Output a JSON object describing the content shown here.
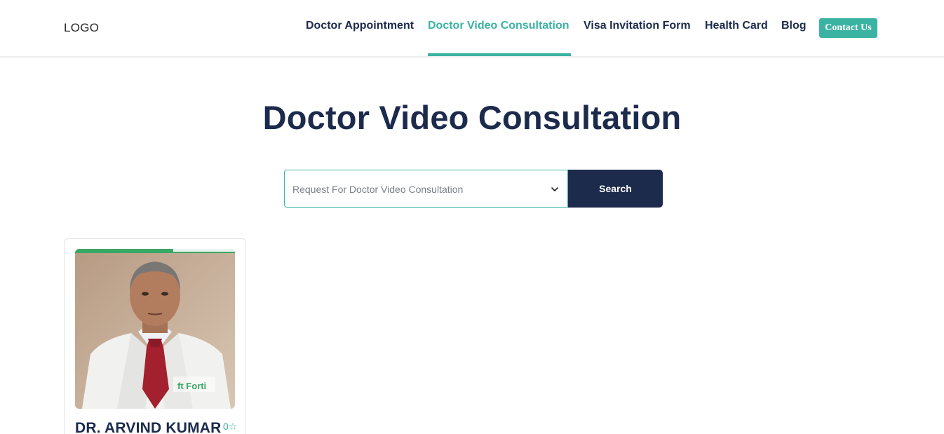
{
  "header": {
    "logo": "LOGO",
    "nav": [
      {
        "label": "Doctor Appointment",
        "active": false
      },
      {
        "label": "Doctor Video Consultation",
        "active": true
      },
      {
        "label": "Visa Invitation Form",
        "active": false
      },
      {
        "label": "Health Card",
        "active": false
      },
      {
        "label": "Blog",
        "active": false
      }
    ],
    "contact_label": "Contact Us"
  },
  "main": {
    "title": "Doctor Video Consultation",
    "search": {
      "select_value": "Request For Doctor Video Consultation",
      "button_label": "Search"
    }
  },
  "doctors": [
    {
      "name": "DR. ARVIND KUMAR",
      "rating": "0",
      "rating_icon": "star-icon"
    }
  ],
  "colors": {
    "accent": "#3bb3a3",
    "navy": "#1c2a4c"
  }
}
